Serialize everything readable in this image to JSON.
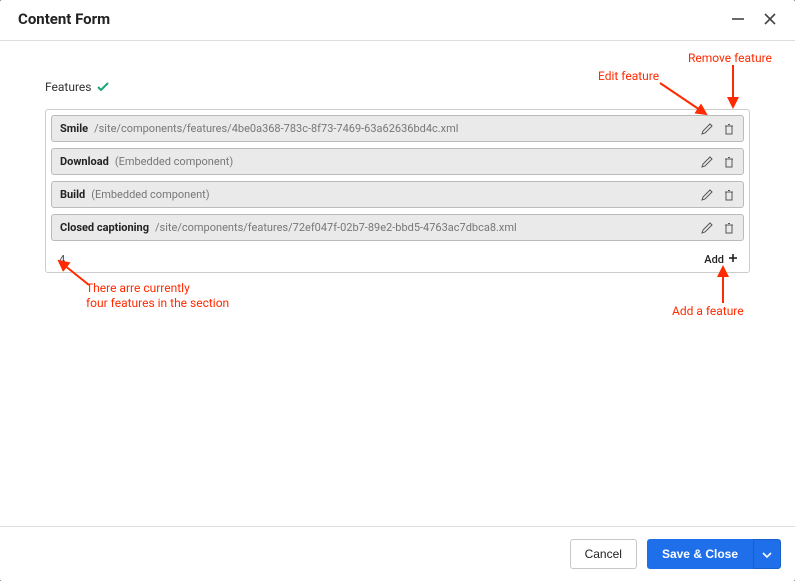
{
  "dialog": {
    "title": "Content Form"
  },
  "section": {
    "label": "Features"
  },
  "features": [
    {
      "title": "Smile",
      "sub": "/site/components/features/4be0a368-783c-8f73-7469-63a62636bd4c.xml"
    },
    {
      "title": "Download",
      "sub": "(Embedded component)"
    },
    {
      "title": "Build",
      "sub": "(Embedded component)"
    },
    {
      "title": "Closed captioning",
      "sub": "/site/components/features/72ef047f-02b7-89e2-bbd5-4763ac7dbca8.xml"
    }
  ],
  "list_footer": {
    "count": "4",
    "add": "Add"
  },
  "annotations": {
    "edit": "Edit feature",
    "remove": "Remove feature",
    "count_note_line1": "There arre currently",
    "count_note_line2": "four features in the section",
    "add_note": "Add a feature"
  },
  "footer": {
    "cancel": "Cancel",
    "save": "Save & Close"
  }
}
